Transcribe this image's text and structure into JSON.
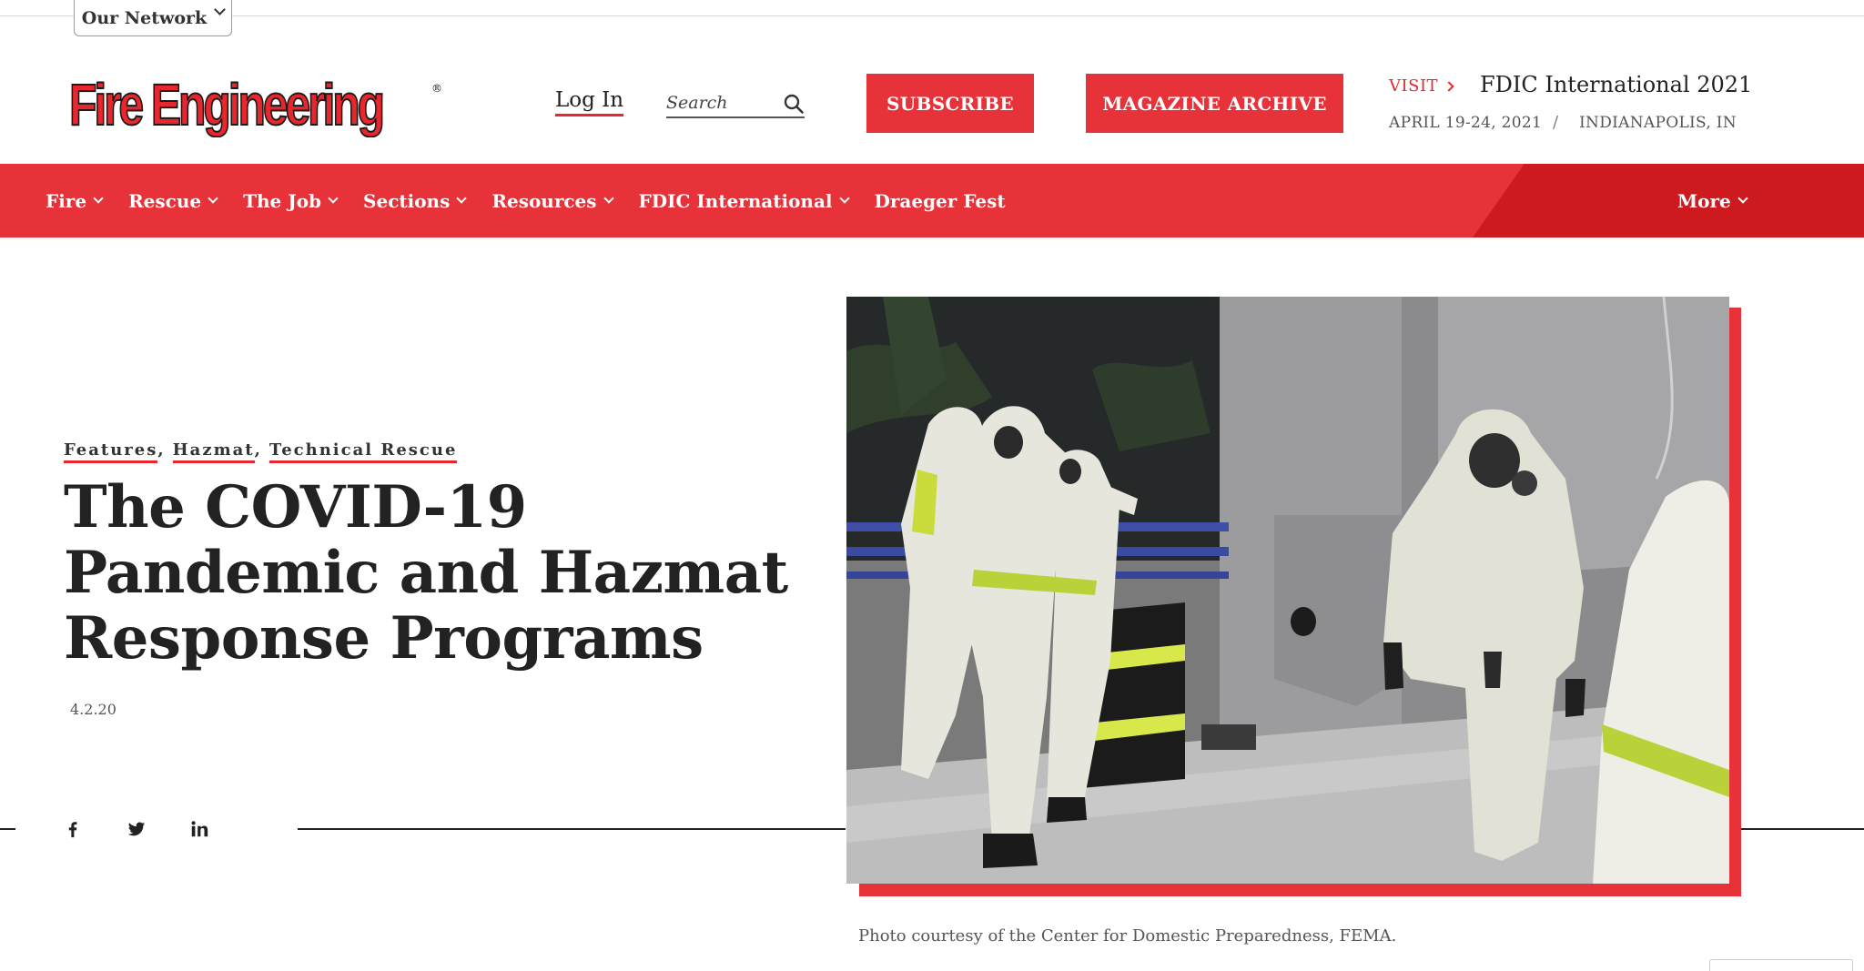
{
  "network": {
    "label": "Our Network"
  },
  "brand": {
    "logo_text": "Fire Engineering",
    "reg_mark": "®",
    "accent": "#e8323a",
    "accent_dark": "#cc1a1f"
  },
  "header": {
    "login": "Log In",
    "search_placeholder": "Search",
    "subscribe": "SUBSCRIBE",
    "archive": "MAGAZINE ARCHIVE",
    "visit": "VISIT",
    "event_title": "FDIC International 2021",
    "event_date": "APRIL 19-24, 2021",
    "event_sep": "/",
    "event_place": "INDIANAPOLIS, IN"
  },
  "nav": {
    "items": [
      {
        "label": "Fire"
      },
      {
        "label": "Rescue"
      },
      {
        "label": "The Job"
      },
      {
        "label": "Sections"
      },
      {
        "label": "Resources"
      },
      {
        "label": "FDIC International"
      },
      {
        "label": "Draeger Fest"
      }
    ],
    "more": "More"
  },
  "article": {
    "tags": [
      "Features",
      "Hazmat",
      "Technical Rescue"
    ],
    "tag_sep": ",",
    "title": "The COVID-19 Pandemic and Hazmat Response Programs",
    "date": "4.2.20",
    "caption": "Photo courtesy of the Center for Domestic Preparedness, FEMA."
  },
  "social": [
    "facebook-icon",
    "twitter-icon",
    "linkedin-icon"
  ]
}
